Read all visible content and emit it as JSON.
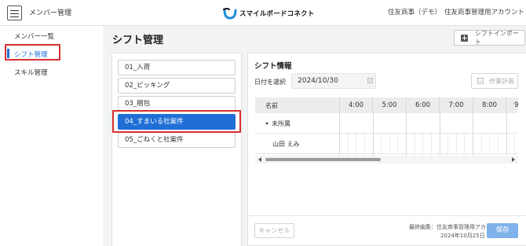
{
  "header": {
    "menu_icon": "hamburger-menu-icon",
    "title": "メンバー管理",
    "logo_text": "スマイルボードコネクト",
    "company": "住友商事（デモ）",
    "account": "住友商事管理用アカウント"
  },
  "sidebar": {
    "items": [
      {
        "label": "メンバー一覧"
      },
      {
        "label": "シフト管理",
        "active": true
      },
      {
        "label": "スキル管理"
      }
    ]
  },
  "page": {
    "title": "シフト管理",
    "import_button": "シフトインポート",
    "import_icon": "plus-square-icon"
  },
  "projects": [
    {
      "label": "01_入荷"
    },
    {
      "label": "02_ピッキング"
    },
    {
      "label": "03_梱包"
    },
    {
      "label": "04_すまいる社案件",
      "selected": true
    },
    {
      "label": "05_ごねくと社案件"
    }
  ],
  "shift": {
    "title": "シフト情報",
    "date_label": "日付を選択",
    "date_value": "2024/10/30",
    "plan_button": "作業計画",
    "grid": {
      "name_header": "名前",
      "hours": [
        "4:00",
        "5:00",
        "6:00",
        "7:00",
        "8:00",
        "9"
      ],
      "group_label": "未所属",
      "member_name": "山田 えみ"
    }
  },
  "footer": {
    "cancel": "キャンセル",
    "last_edit_label": "最終編集：住友商事管理用アカウント",
    "last_edit_time": "2024年10月25日 20:11",
    "save": "保存"
  },
  "colors": {
    "accent": "#1f6fd6",
    "save_disabled": "#7fb2ea",
    "highlight": "#d93030"
  }
}
